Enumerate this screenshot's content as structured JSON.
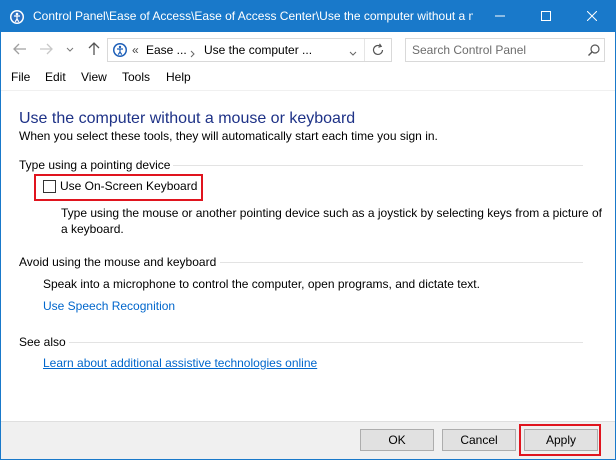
{
  "window": {
    "title": "Control Panel\\Ease of Access\\Ease of Access Center\\Use the computer without a m...",
    "accent_color": "#1979ca",
    "controls": {
      "minimize_icon": "minimize-icon",
      "maximize_icon": "maximize-icon",
      "close_icon": "close-icon"
    }
  },
  "navigation": {
    "back_icon": "arrow-left-icon",
    "forward_icon": "arrow-right-icon",
    "recent_icon": "chevron-down-icon",
    "up_icon": "arrow-up-icon",
    "address": {
      "overflow": "«",
      "breadcrumbs": [
        "Ease ...",
        "Use the computer ..."
      ],
      "refresh_icon": "refresh-icon"
    },
    "search": {
      "placeholder": "Search Control Panel",
      "value": ""
    }
  },
  "menu": {
    "items": [
      "File",
      "Edit",
      "View",
      "Tools",
      "Help"
    ]
  },
  "main": {
    "title": "Use the computer without a mouse or keyboard",
    "subtitle": "When you select these tools, they will automatically start each time you sign in.",
    "sections": [
      {
        "heading": "Type using a pointing device",
        "checkbox": {
          "label": "Use On-Screen Keyboard",
          "checked": false,
          "highlighted": true
        },
        "description": "Type using the mouse or another pointing device such as a joystick by selecting keys from a picture of a keyboard."
      },
      {
        "heading": "Avoid using the mouse and keyboard",
        "description": "Speak into a microphone to control the computer, open programs, and dictate text.",
        "link": "Use Speech Recognition"
      },
      {
        "heading": "See also",
        "link": "Learn about additional assistive technologies online"
      }
    ]
  },
  "footer": {
    "ok_label": "OK",
    "cancel_label": "Cancel",
    "apply_label": "Apply",
    "apply_highlighted": true
  },
  "colors": {
    "link": "#0066cc",
    "title_text": "#1e3287",
    "highlight": "#e0141e"
  }
}
